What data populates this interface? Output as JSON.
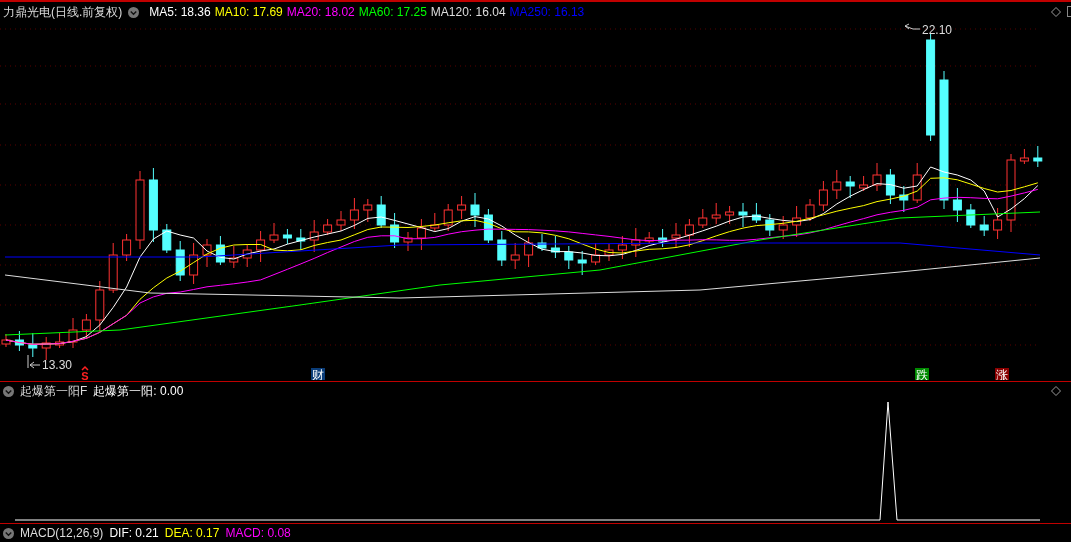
{
  "main_panel": {
    "stock_name": "力鼎光电(日线.前复权)",
    "indicators": [
      {
        "label": "MA5: 18.36",
        "color": "#ffffff"
      },
      {
        "label": "MA10: 17.69",
        "color": "#ffff00"
      },
      {
        "label": "MA20: 18.02",
        "color": "#ff00ff"
      },
      {
        "label": "MA60: 17.25",
        "color": "#00ff00"
      },
      {
        "label": "MA120: 16.04",
        "color": "#dddddd"
      },
      {
        "label": "MA250: 16.13",
        "color": "#0000ff"
      }
    ],
    "high_label": "22.10",
    "low_label": "13.30",
    "markers": [
      {
        "kind": "signal",
        "text": "S"
      },
      {
        "kind": "finance",
        "text": "财"
      },
      {
        "kind": "fall",
        "text": "跌"
      },
      {
        "kind": "rise",
        "text": "涨"
      }
    ]
  },
  "sub_panel": {
    "title": "起爆第一阳F",
    "readout": "起爆第一阳: 0.00"
  },
  "macd_panel": {
    "title": "MACD(12,26,9)",
    "values": [
      {
        "label": "DIF: 0.21",
        "color": "#ffffff"
      },
      {
        "label": "DEA: 0.17",
        "color": "#ffff00"
      },
      {
        "label": "MACD: 0.08",
        "color": "#ff00ff"
      }
    ]
  }
}
